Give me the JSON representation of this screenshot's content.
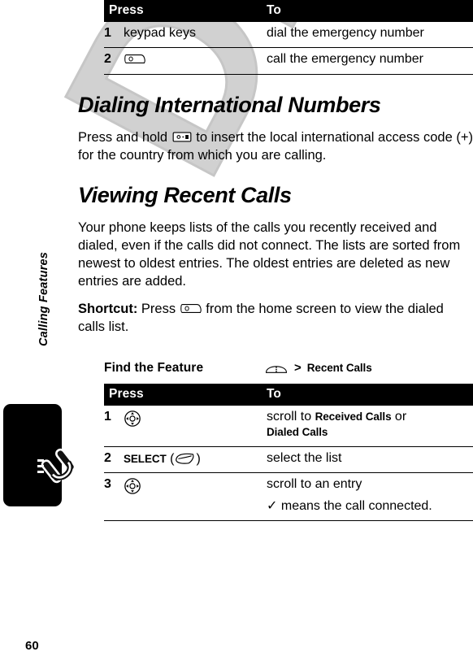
{
  "page": {
    "number": "60",
    "chapter_label": "Calling Features",
    "watermark": "DRAFT",
    "chapter_tab_icon": "phone-handset-icon"
  },
  "top_table": {
    "headers": {
      "press": "Press",
      "to": "To"
    },
    "rows": [
      {
        "num": "1",
        "press_text": "keypad keys",
        "press_icon": "",
        "to": "dial the emergency number"
      },
      {
        "num": "2",
        "press_text": "",
        "press_icon": "send-key-icon",
        "to": "call the emergency number"
      }
    ]
  },
  "section_international": {
    "heading": "Dialing International Numbers",
    "para_before_icon": "Press and hold ",
    "icon": "zero-key-icon",
    "para_after_icon": " to insert the local international access code (+) for the country from which you are calling."
  },
  "section_recent": {
    "heading": "Viewing Recent Calls",
    "paragraph": "Your phone keeps lists of the calls you recently received and dialed, even if the calls did not connect. The lists are sorted from newest to oldest entries. The oldest entries are deleted as new entries are added.",
    "shortcut_label": "Shortcut:",
    "shortcut_before_icon": " Press ",
    "shortcut_icon": "send-key-icon",
    "shortcut_after_icon": " from the home screen to view the dialed calls list."
  },
  "find_the_feature": {
    "label": "Find the Feature",
    "menu_icon": "menu-key-icon",
    "separator": ">",
    "path": "Recent Calls"
  },
  "steps_table": {
    "headers": {
      "press": "Press",
      "to": "To"
    },
    "rows": [
      {
        "num": "1",
        "press_icon": "navigation-key-icon",
        "press_text": "",
        "to_prefix": "scroll to ",
        "to_bold_1": "Received Calls",
        "to_middle": " or",
        "to_bold_2": "Dialed Calls",
        "to_suffix": ""
      },
      {
        "num": "2",
        "press_icon": "softkey-icon",
        "press_text": "SELECT",
        "to_prefix": "select the list",
        "to_bold_1": "",
        "to_middle": "",
        "to_bold_2": "",
        "to_suffix": ""
      },
      {
        "num": "3",
        "press_icon": "navigation-key-icon",
        "press_text": "",
        "to_prefix": "scroll to an entry",
        "to_bold_1": "",
        "to_middle": "",
        "to_bold_2": "",
        "to_suffix": "means the call connected.",
        "to_suffix_icon": "checkmark-icon"
      }
    ]
  },
  "colors": {
    "header_bg": "#000000",
    "header_text": "#ffffff",
    "body_text": "#000000",
    "watermark": "#c9c9c9"
  }
}
